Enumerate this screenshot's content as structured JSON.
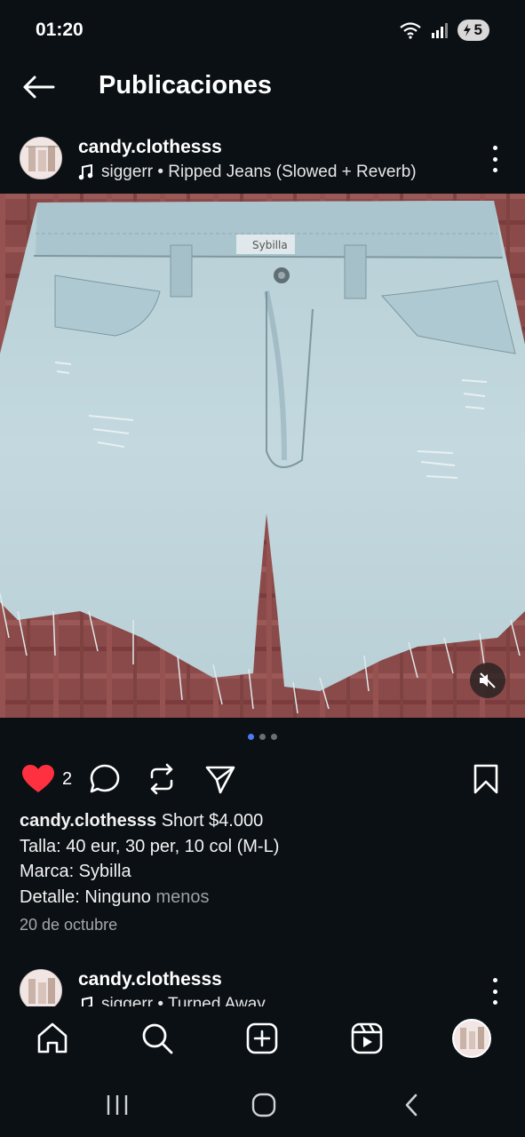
{
  "status_bar": {
    "time": "01:20",
    "battery": "5"
  },
  "header": {
    "title": "Publicaciones"
  },
  "post": {
    "username": "candy.clothesss",
    "audio": "siggerr • Ripped Jeans (Slowed + Reverb)",
    "image_label": "Sybilla",
    "carousel": {
      "count": 3,
      "active_index": 0
    },
    "likes": "2",
    "caption": {
      "username": "candy.clothesss",
      "line1": "Short $4.000",
      "line2": "Talla: 40 eur, 30 per, 10 col (M-L)",
      "line3": "Marca: Sybilla",
      "line4": "Detalle: Ninguno",
      "less": "menos"
    },
    "date": "20 de octubre"
  },
  "next_post": {
    "username": "candy.clothesss",
    "audio": "siggerr • Turned Away"
  },
  "colors": {
    "background": "#0b1014",
    "like_red": "#ff3040",
    "carousel_active": "#4b7bf5"
  }
}
